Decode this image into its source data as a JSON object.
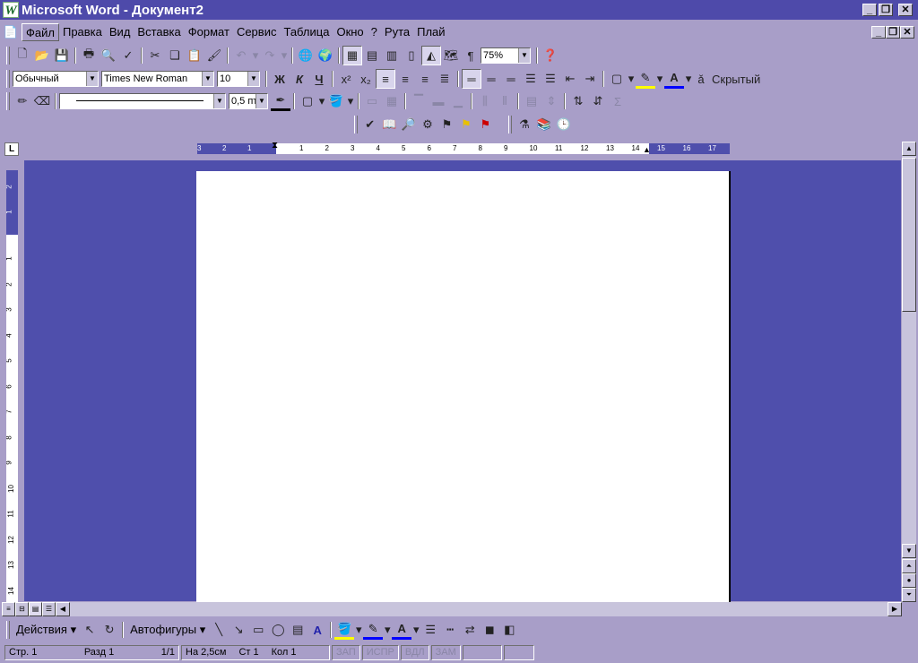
{
  "title": {
    "app_icon": "W",
    "text": "Microsoft Word - Документ2"
  },
  "window_buttons": {
    "minimize": "_",
    "restore": "❐",
    "close": "✕"
  },
  "menu": [
    "Файл",
    "Правка",
    "Вид",
    "Вставка",
    "Формат",
    "Сервис",
    "Таблица",
    "Окно",
    "?",
    "Рута",
    "Плай"
  ],
  "standard_toolbar": {
    "zoom": "75%"
  },
  "format_toolbar": {
    "style": "Обычный",
    "font": "Times New Roman",
    "size": "10",
    "bold": "Ж",
    "italic": "К",
    "underline": "Ч",
    "hidden": "Скрытый"
  },
  "tables_toolbar": {
    "line_width": "0,5 пт",
    "sum": "Σ"
  },
  "ruler": {
    "corner": "L",
    "h_labels": [
      "3",
      "2",
      "1",
      "1",
      "2",
      "3",
      "4",
      "5",
      "6",
      "7",
      "8",
      "9",
      "10",
      "11",
      "12",
      "13",
      "14",
      "15",
      "16",
      "17"
    ],
    "v_labels": [
      "2",
      "1",
      "1",
      "2",
      "3",
      "4",
      "5",
      "6",
      "7",
      "8",
      "9",
      "10",
      "11",
      "12",
      "13",
      "14"
    ]
  },
  "drawing_toolbar": {
    "actions": "Действия",
    "autoshapes": "Автофигуры"
  },
  "status": {
    "page": "Стр. 1",
    "section": "Разд 1",
    "pages": "1/1",
    "at": "На 2,5см",
    "line": "Ст 1",
    "col": "Кол 1",
    "rec": "ЗАП",
    "trk": "ИСПР",
    "ext": "ВДЛ",
    "ovr": "ЗАМ"
  },
  "colors": {
    "workspace": "#4f4fac",
    "chrome": "#a89ec8",
    "title": "#4e4aaa"
  }
}
